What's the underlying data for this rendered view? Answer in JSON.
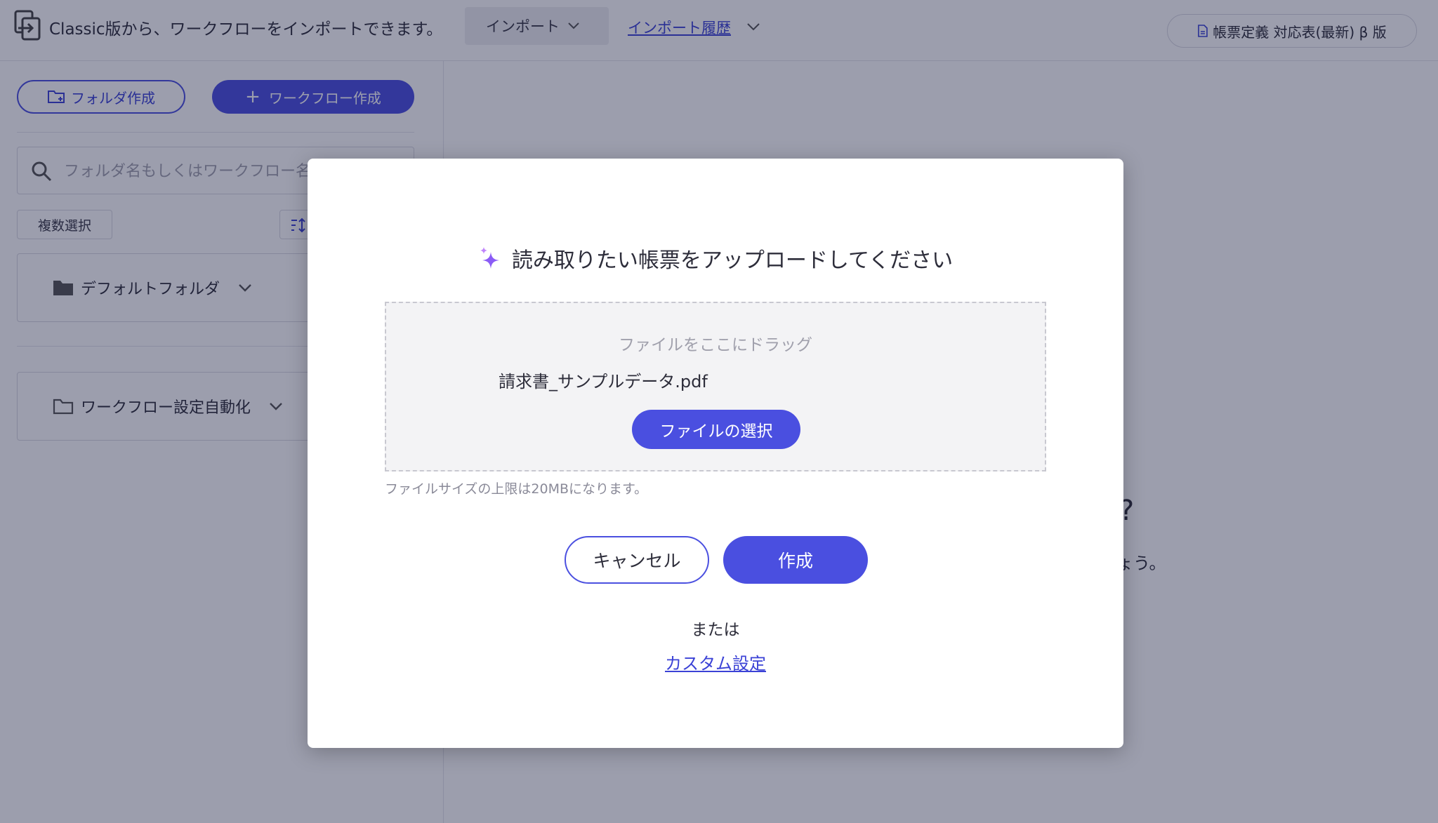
{
  "topbar": {
    "import_message": "Classic版から、ワークフローをインポートできます。",
    "import_dropdown_label": "インポート",
    "import_history_link": "インポート履歴",
    "doc_definition_button": "帳票定義 対応表(最新) β 版"
  },
  "sidebar": {
    "create_folder_label": "フォルダ作成",
    "create_workflow_label": "ワークフロー作成",
    "search_placeholder": "フォルダ名もしくはワークフロー名",
    "multi_select_label": "複数選択",
    "folders": [
      {
        "name": "デフォルトフォルダ"
      },
      {
        "name": "ワークフロー設定自動化"
      }
    ]
  },
  "main": {
    "heading_fragment": "?",
    "text_fragment": "ょう。"
  },
  "modal": {
    "title": "読み取りたい帳票をアップロードしてください",
    "drop_hint": "ファイルをここにドラッグ",
    "selected_file": "請求書_サンプルデータ.pdf",
    "select_file_button": "ファイルの選択",
    "size_note": "ファイルサイズの上限は20MBになります。",
    "cancel_button": "キャンセル",
    "create_button": "作成",
    "or_text": "または",
    "custom_link": "カスタム設定"
  },
  "colors": {
    "accent": "#4a4fe0",
    "link": "#3b42d6",
    "sparkle": "#8b5cf6"
  }
}
